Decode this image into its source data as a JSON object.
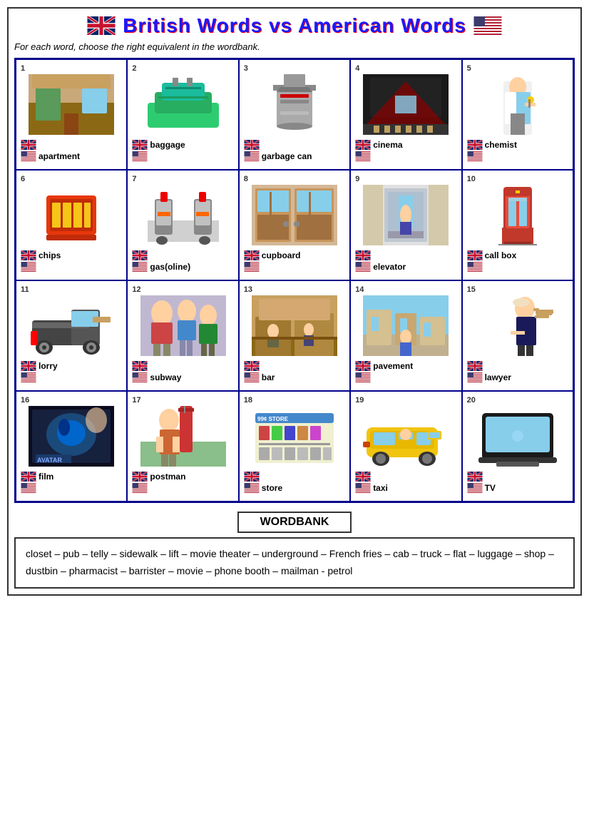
{
  "title": "British Words vs American Words",
  "instruction": "For each word, choose the right equivalent in the wordbank.",
  "cells": [
    {
      "num": 1,
      "uk_word": "",
      "us_word": "apartment",
      "img_type": "room"
    },
    {
      "num": 2,
      "uk_word": "baggage",
      "us_word": "",
      "img_type": "luggage"
    },
    {
      "num": 3,
      "uk_word": "",
      "us_word": "garbage can",
      "img_type": "bin"
    },
    {
      "num": 4,
      "uk_word": "cinema",
      "us_word": "",
      "img_type": "cinema"
    },
    {
      "num": 5,
      "uk_word": "chemist",
      "us_word": "",
      "img_type": "chemist"
    },
    {
      "num": 6,
      "uk_word": "chips",
      "us_word": "",
      "img_type": "chips"
    },
    {
      "num": 7,
      "uk_word": "",
      "us_word": "gas(oline)",
      "img_type": "petrol"
    },
    {
      "num": 8,
      "uk_word": "cupboard",
      "us_word": "",
      "img_type": "cupboard"
    },
    {
      "num": 9,
      "uk_word": "",
      "us_word": "elevator",
      "img_type": "elevator"
    },
    {
      "num": 10,
      "uk_word": "call box",
      "us_word": "",
      "img_type": "callbox"
    },
    {
      "num": 11,
      "uk_word": "lorry",
      "us_word": "",
      "img_type": "lorry"
    },
    {
      "num": 12,
      "uk_word": "",
      "us_word": "subway",
      "img_type": "subway"
    },
    {
      "num": 13,
      "uk_word": "",
      "us_word": "bar",
      "img_type": "bar"
    },
    {
      "num": 14,
      "uk_word": "pavement",
      "us_word": "",
      "img_type": "pavement"
    },
    {
      "num": 15,
      "uk_word": "",
      "us_word": "lawyer",
      "img_type": "lawyer"
    },
    {
      "num": 16,
      "uk_word": "film",
      "us_word": "",
      "img_type": "film"
    },
    {
      "num": 17,
      "uk_word": "postman",
      "us_word": "",
      "img_type": "postman"
    },
    {
      "num": 18,
      "uk_word": "",
      "us_word": "store",
      "img_type": "store"
    },
    {
      "num": 19,
      "uk_word": "",
      "us_word": "taxi",
      "img_type": "taxi"
    },
    {
      "num": 20,
      "uk_word": "",
      "us_word": "TV",
      "img_type": "tv"
    }
  ],
  "wordbank_title": "WORDBANK",
  "wordbank_text": "closet – pub – telly – sidewalk – lift – movie theater – underground – French fries – cab – truck – flat – luggage – shop – dustbin – pharmacist – barrister – movie – phone booth – mailman - petrol"
}
